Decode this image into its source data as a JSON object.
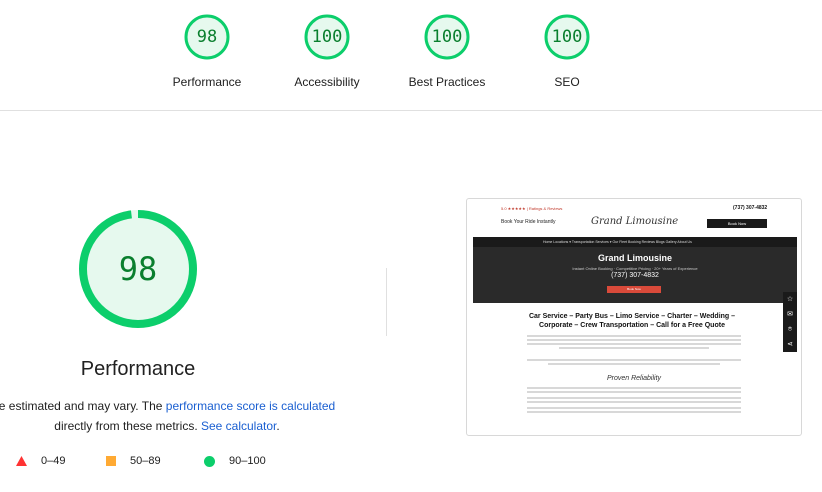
{
  "categories": [
    {
      "score": "98",
      "label": "Performance"
    },
    {
      "score": "100",
      "label": "Accessibility"
    },
    {
      "score": "100",
      "label": "Best Practices"
    },
    {
      "score": "100",
      "label": "SEO"
    }
  ],
  "main": {
    "score": "98",
    "title": "Performance",
    "note_prefix": "e estimated and may vary. The ",
    "note_link1": "performance score is calculated",
    "note_mid": "directly from these metrics. ",
    "note_link2": "See calculator",
    "note_end": "."
  },
  "legend": [
    {
      "range": "0–49",
      "icon": "triangle-icon",
      "color": "#ff3333"
    },
    {
      "range": "50–89",
      "icon": "square-icon",
      "color": "#ffaa33"
    },
    {
      "range": "90–100",
      "icon": "circle-icon",
      "color": "#0cce6b"
    }
  ],
  "colors": {
    "pass_ring": "#0cce6b",
    "pass_fill": "#e6f9ee",
    "pass_text": "#0a7f2e",
    "link": "#1a5fd1"
  },
  "screenshot": {
    "rating": "5.0 ★★★★★ | Ratings & Reviews",
    "phone": "(737) 307-4832",
    "book_text": "Book Your Ride Instantly",
    "logo": "Grand Limousine",
    "book_button": "Book Now",
    "nav": "Home    Locations ▾    Transportation Services ▾    Our Fleet    Booking    Reviews    Blogs    Gallery    About Us",
    "hero_title": "Grand Limousine",
    "hero_subtitle": "Instant Online Booking · Competitive Pricing · 20+ Years of Experience",
    "hero_phone": "(737) 307-4832",
    "hero_button": "Book Now",
    "heading": "Car Service – Party Bus – Limo Service – Charter – Wedding – Corporate – Crew Transportation – Call for a Free Quote",
    "proven": "Proven Reliability"
  }
}
